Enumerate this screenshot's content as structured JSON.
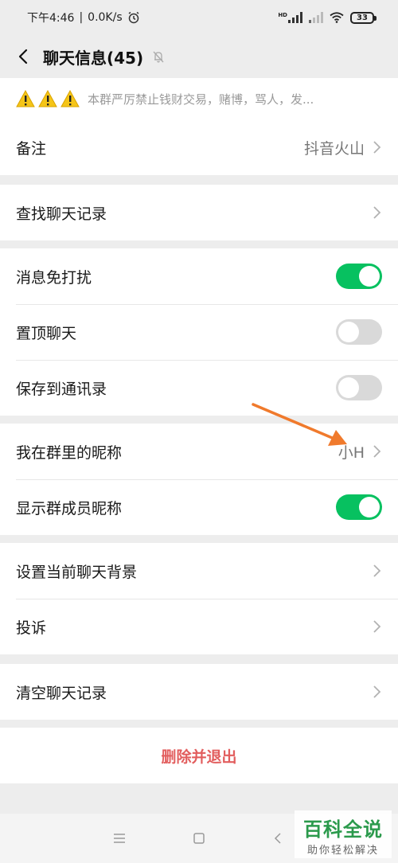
{
  "status": {
    "time": "下午4:46",
    "network_speed": "0.0K/s",
    "separator": "|",
    "signal_label": "HD",
    "battery": "33"
  },
  "header": {
    "title": "聊天信息(45)"
  },
  "notice": {
    "text": "本群严厉禁止钱财交易，赌博，骂人，发..."
  },
  "rows": {
    "remark": {
      "label": "备注",
      "value": "抖音火山"
    },
    "search_history": {
      "label": "查找聊天记录"
    },
    "mute": {
      "label": "消息免打扰",
      "on": true
    },
    "pin": {
      "label": "置顶聊天",
      "on": false
    },
    "save_contacts": {
      "label": "保存到通讯录",
      "on": false
    },
    "nickname": {
      "label": "我在群里的昵称",
      "value": "小H"
    },
    "show_nicknames": {
      "label": "显示群成员昵称",
      "on": true
    },
    "background": {
      "label": "设置当前聊天背景"
    },
    "report": {
      "label": "投诉"
    },
    "clear_history": {
      "label": "清空聊天记录"
    }
  },
  "delete_exit": {
    "label": "删除并退出"
  },
  "watermark": {
    "main": "百科全说",
    "sub": "助你轻松解决"
  },
  "colors": {
    "toggle_on": "#07c160",
    "danger": "#e25e5e",
    "arrow": "#f07a2c"
  }
}
